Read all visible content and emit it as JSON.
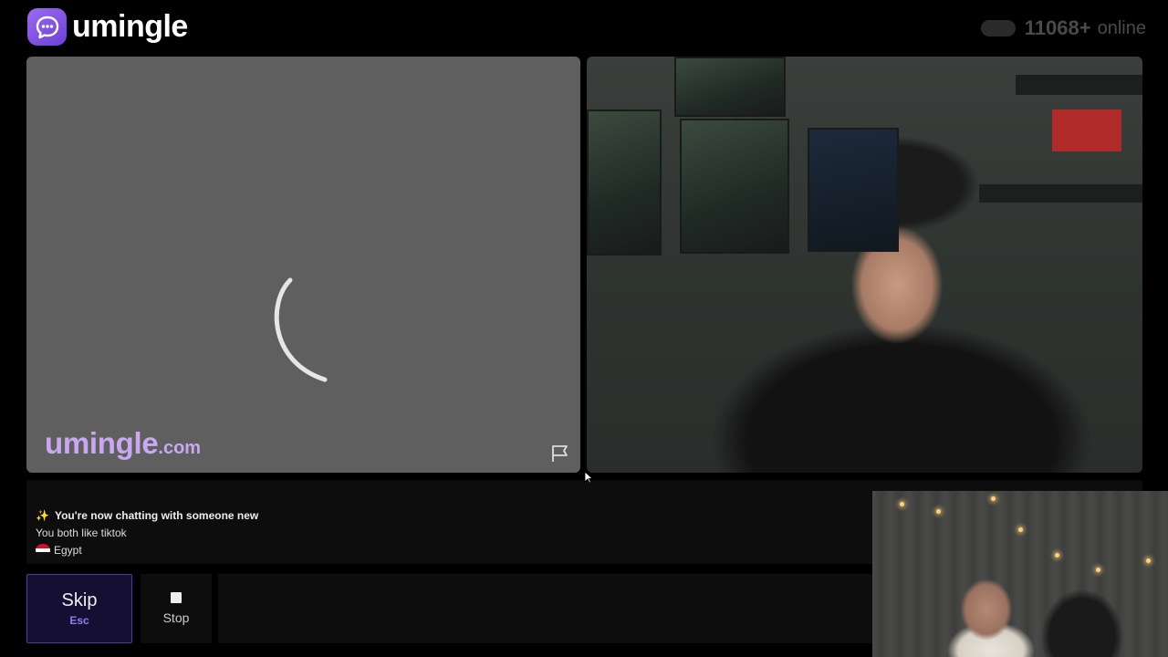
{
  "header": {
    "brand": "umingle",
    "online_count": "11068+",
    "online_label": "online"
  },
  "stranger_video": {
    "watermark_main": "umingle",
    "watermark_suffix": ".com",
    "loading": true,
    "icons": [
      "spinner-icon",
      "report-flag-icon"
    ]
  },
  "chat": {
    "line1": "You're now chatting with someone new",
    "line2": "You both like tiktok",
    "country": "Egypt",
    "icons": [
      "sparkle-icon",
      "egypt-flag-icon"
    ]
  },
  "controls": {
    "skip_label": "Skip",
    "skip_key": "Esc",
    "stop_label": "Stop"
  },
  "colors": {
    "brand_purple": "#7c4ee4",
    "skip_accent": "#8f7cf0",
    "watermark": "#c8a8f0",
    "background": "#000000"
  }
}
